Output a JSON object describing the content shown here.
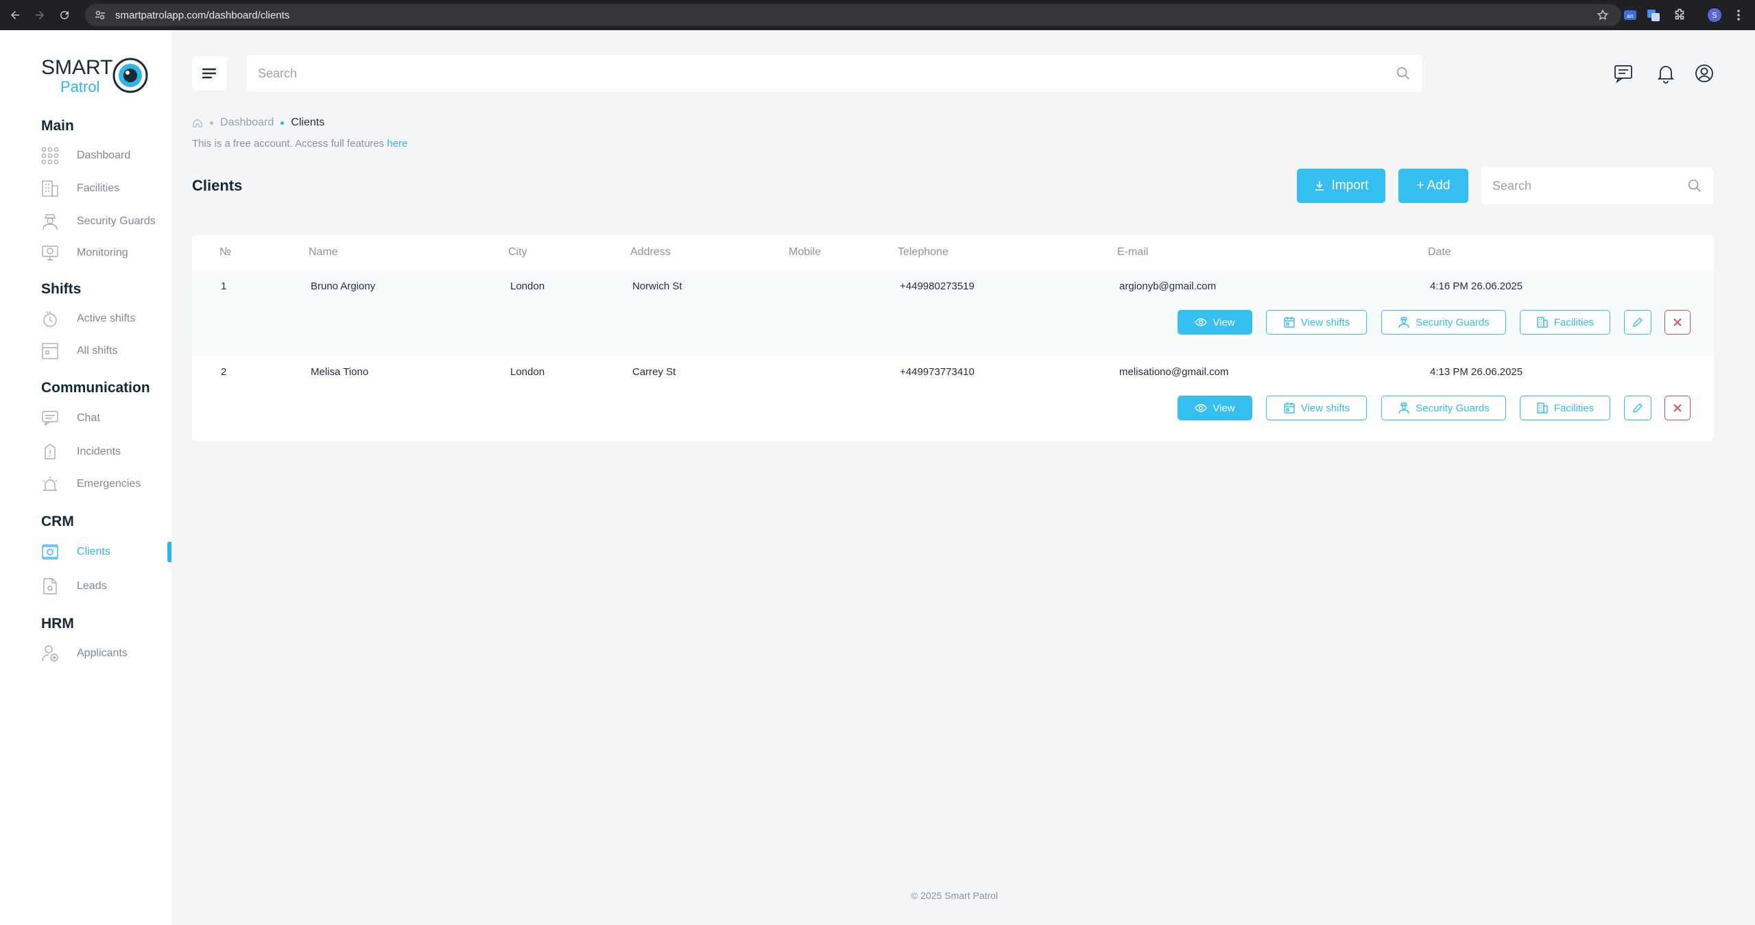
{
  "browser": {
    "url": "smartpatrolapp.com/dashboard/clients"
  },
  "logo": {
    "line1": "SMART",
    "line2": "Patrol"
  },
  "sidebar": {
    "sections": [
      {
        "title": "Main",
        "items": [
          {
            "label": "Dashboard",
            "icon": "grid-icon"
          },
          {
            "label": "Facilities",
            "icon": "building-icon"
          },
          {
            "label": "Security Guards",
            "icon": "guard-icon"
          },
          {
            "label": "Monitoring",
            "icon": "monitor-icon"
          }
        ]
      },
      {
        "title": "Shifts",
        "items": [
          {
            "label": "Active shifts",
            "icon": "clock-hand-icon"
          },
          {
            "label": "All shifts",
            "icon": "calendar-icon"
          }
        ]
      },
      {
        "title": "Communication",
        "items": [
          {
            "label": "Chat",
            "icon": "chat-icon"
          },
          {
            "label": "Incidents",
            "icon": "incident-icon"
          },
          {
            "label": "Emergencies",
            "icon": "alarm-icon"
          }
        ]
      },
      {
        "title": "CRM",
        "items": [
          {
            "label": "Clients",
            "icon": "money-icon",
            "active": true
          },
          {
            "label": "Leads",
            "icon": "document-icon"
          }
        ]
      },
      {
        "title": "HRM",
        "items": [
          {
            "label": "Applicants",
            "icon": "applicant-icon"
          }
        ]
      }
    ]
  },
  "header": {
    "search_placeholder": "Search"
  },
  "breadcrumb": {
    "parent": "Dashboard",
    "current": "Clients"
  },
  "notice": {
    "text": "This is a free account. Access full features ",
    "link": "here"
  },
  "page": {
    "title": "Clients",
    "import_label": "Import",
    "add_label": "+ Add",
    "search_placeholder": "Search"
  },
  "table": {
    "columns": [
      "№",
      "Name",
      "City",
      "Address",
      "Mobile",
      "Telephone",
      "E-mail",
      "Date"
    ],
    "rows": [
      {
        "no": "1",
        "name": "Bruno Argiony",
        "city": "London",
        "address": "Norwich St",
        "mobile": "",
        "telephone": "+449980273519",
        "email": "argionyb@gmail.com",
        "date": "4:16 PM 26.06.2025"
      },
      {
        "no": "2",
        "name": "Melisa Tiono",
        "city": "London",
        "address": "Carrey St",
        "mobile": "",
        "telephone": "+449973773410",
        "email": "melisationo@gmail.com",
        "date": "4:13 PM 26.06.2025"
      }
    ],
    "actions": {
      "view": "View",
      "view_shifts": "View shifts",
      "security_guards": "Security Guards",
      "facilities": "Facilities"
    }
  },
  "footer": {
    "text": "© 2025 Smart Patrol"
  },
  "colors": {
    "accent": "#35bff0",
    "danger": "#d9534f",
    "sidebar_bg": "#ffffff",
    "page_bg": "#f4f5f7"
  }
}
